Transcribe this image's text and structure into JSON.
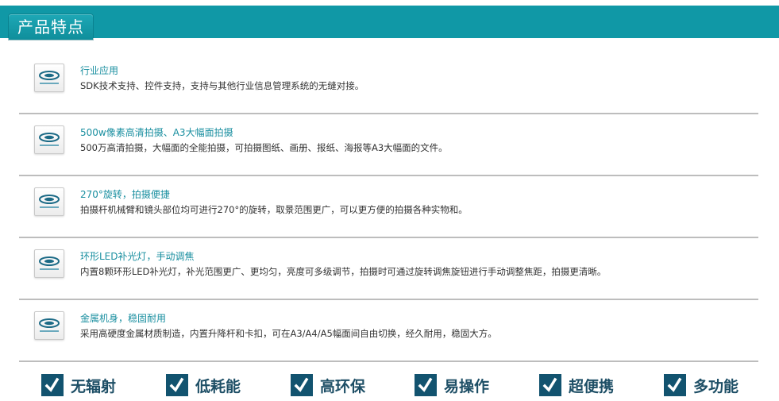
{
  "header": {
    "title": "产品特点"
  },
  "features": [
    {
      "icon": "scanner-logo-icon",
      "title": "行业应用",
      "desc": "SDK技术支持、控件支持，支持与其他行业信息管理系统的无缝对接。"
    },
    {
      "icon": "scanner-logo-icon",
      "title": "500w像素高清拍摄、A3大幅面拍摄",
      "desc": "500万高清拍摄，大幅面的全能拍摄，可拍摄图纸、画册、报纸、海报等A3大幅面的文件。"
    },
    {
      "icon": "scanner-logo-icon",
      "title": "270°旋转，拍摄便捷",
      "desc": "拍摄杆机械臂和镜头部位均可进行270°的旋转，取景范围更广，可以更方便的拍摄各种实物和。"
    },
    {
      "icon": "scanner-logo-icon",
      "title": "环形LED补光灯，手动调焦",
      "desc": "内置8颗环形LED补光灯，补光范围更广、更均匀，亮度可多级调节，拍摄时可通过旋转调焦旋钮进行手动调整焦距，拍摄更清晰。"
    },
    {
      "icon": "scanner-logo-icon",
      "title": "金属机身，稳固耐用",
      "desc": "采用高硬度金属材质制造，内置升降杆和卡扣，可在A3/A4/A5幅面间自由切换，经久耐用，稳固大方。"
    }
  ],
  "badges": [
    {
      "label": "无辐射",
      "icon": "checkmark-icon"
    },
    {
      "label": "低耗能",
      "icon": "checkmark-icon"
    },
    {
      "label": "高环保",
      "icon": "checkmark-icon"
    },
    {
      "label": "易操作",
      "icon": "checkmark-icon"
    },
    {
      "label": "超便携",
      "icon": "checkmark-icon"
    },
    {
      "label": "多功能",
      "icon": "checkmark-icon"
    }
  ],
  "colors": {
    "header_bg": "#1098a6",
    "title_text": "#1a8fa0",
    "badge_box": "#12536f",
    "badge_text": "#1e4f66"
  }
}
